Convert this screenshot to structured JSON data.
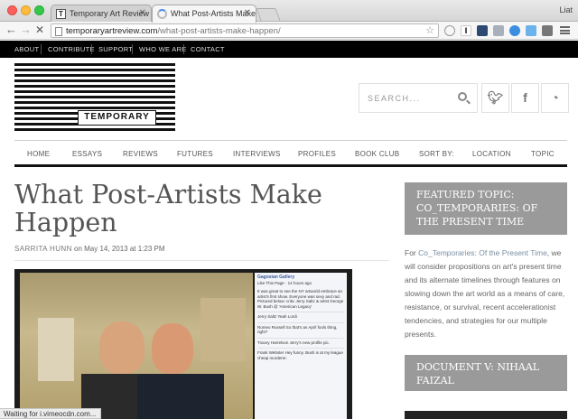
{
  "browser": {
    "tabs": [
      {
        "label": "Temporary Art Review | an",
        "active": false
      },
      {
        "label": "What Post-Artists Make Ha",
        "active": true
      }
    ],
    "profile": "Liat",
    "url": {
      "host": "temporaryartreview.com",
      "path": "/what-post-artists-make-happen/"
    },
    "status_text": "Waiting for i.vimeocdn.com..."
  },
  "site": {
    "top_nav": [
      "ABOUT",
      "CONTRIBUTE",
      "SUPPORT",
      "WHO WE ARE",
      "CONTACT"
    ],
    "logo_word": "TEMPORARY",
    "search_placeholder": "SEARCH...",
    "social": [
      "twitter-icon",
      "facebook-icon",
      "rss-icon"
    ],
    "main_nav": [
      "HOME",
      "ESSAYS",
      "REVIEWS",
      "FUTURES",
      "INTERVIEWS",
      "PROFILES",
      "BOOK CLUB",
      "SORT BY:",
      "LOCATION",
      "TOPIC"
    ]
  },
  "article": {
    "title_line1": "What Post-Artists Make",
    "title_line2": "Happen",
    "author": "SARRITA HUNN",
    "date": "on May 14, 2013 at 1:23 PM",
    "image_panel": {
      "page_name": "Gagosian Gallery",
      "page_sub": "Like This Page · 14 hours ago",
      "post": "It was great to see the NY artworld embrace an artist's first show. Everyone was sexy and rad. Pictured below: critic Jerry Saltz & artist George W. Bush @ 'American Legacy'",
      "comments": [
        "Jerry Saltz Yeah Lordi",
        "Romeo Russell So that's an April fools thing, right?",
        "Tracey Harrelson Jerry's new profile pic.",
        "Frank Webster Hey funny. Bush is at my league cheap murderer."
      ]
    }
  },
  "sidebar": {
    "featured_title": "FEATURED TOPIC: CO_TEMPORARIES: OF THE PRESENT TIME",
    "featured_text_pre": "For ",
    "featured_link": "Co_Temporaries: Of the Present Time",
    "featured_text_post": ", we will consider propositions on art's present time and its alternate timelines through features on slowing down the art world as a means of care, resistance, or survival, recent accelerationist tendencies, and strategies for our multiple presents.",
    "doc_title": "DOCUMENT V: NIHAAL FAIZAL"
  }
}
